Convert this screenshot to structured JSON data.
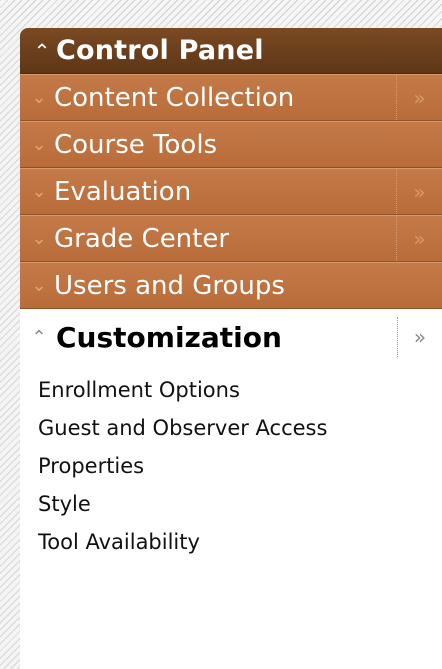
{
  "panel": {
    "title": "Control Panel",
    "title_icon": "double-chevron-up-icon",
    "colors": {
      "header_bg": "#6a3d1b",
      "item_bg": "#be7442",
      "item_text": "#ffffff",
      "arrow": "#e0a47a"
    }
  },
  "menu": {
    "items": [
      {
        "label": "Content Collection",
        "icon": "double-chevron-down-icon",
        "has_more": true
      },
      {
        "label": "Course Tools",
        "icon": "double-chevron-down-icon",
        "has_more": false
      },
      {
        "label": "Evaluation",
        "icon": "double-chevron-down-icon",
        "has_more": true
      },
      {
        "label": "Grade Center",
        "icon": "double-chevron-down-icon",
        "has_more": true
      },
      {
        "label": "Users and Groups",
        "icon": "double-chevron-down-icon",
        "has_more": false
      }
    ]
  },
  "customization": {
    "title": "Customization",
    "icon": "double-chevron-up-icon",
    "more_icon": "double-chevron-right-icon",
    "links": [
      "Enrollment Options",
      "Guest and Observer Access",
      "Properties",
      "Style",
      "Tool Availability"
    ]
  }
}
